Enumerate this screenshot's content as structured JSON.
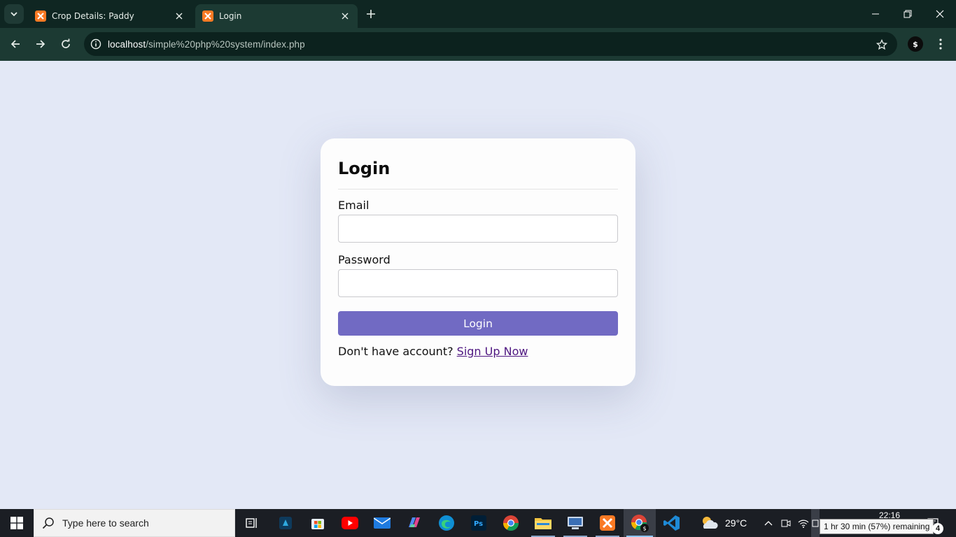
{
  "browser": {
    "tabs": [
      {
        "title": "Crop Details: Paddy",
        "active": false,
        "favicon": "xampp-icon"
      },
      {
        "title": "Login",
        "active": true,
        "favicon": "xampp-icon"
      }
    ],
    "url_host": "localhost",
    "url_path": "/simple%20php%20system/index.php",
    "profile_initial": "$"
  },
  "login": {
    "title": "Login",
    "email_label": "Email",
    "email_value": "",
    "password_label": "Password",
    "password_value": "",
    "submit_label": "Login",
    "signup_prompt": "Don't have account? ",
    "signup_link": "Sign Up Now"
  },
  "colors": {
    "page_background": "#e3e8f6",
    "button": "#716ac3",
    "link": "#4e1680",
    "browser_frame": "#0f2622",
    "browser_toolbar": "#1c3a33"
  },
  "taskbar": {
    "search_placeholder": "Type here to search",
    "apps": [
      "task-view-icon",
      "app-icon",
      "microsoft-store-icon",
      "youtube-icon",
      "mail-icon",
      "m365-icon",
      "edge-icon",
      "photoshop-icon",
      "chrome-icon",
      "file-explorer-icon",
      "network-app-icon",
      "xampp-icon",
      "chrome-profile-icon",
      "vscode-icon"
    ],
    "weather": "29°C",
    "time": "22:16",
    "battery_tooltip": "1 hr 30 min (57%) remaining",
    "notification_count": "4"
  }
}
